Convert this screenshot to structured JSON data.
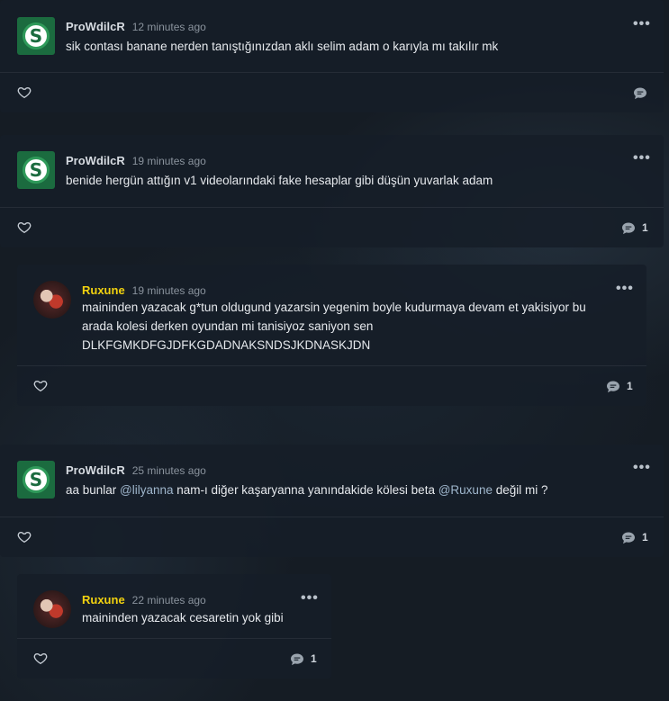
{
  "comments": [
    {
      "author": "ProWdilcR",
      "time": "12 minutes ago",
      "text": "sik contası banane nerden tanıştığınızdan aklı selim adam o karıyla mı takılır mk",
      "reply_count": "",
      "avatar_icon": "s-logo-avatar"
    },
    {
      "author": "ProWdilcR",
      "time": "19 minutes ago",
      "text": "benide hergün attığın v1 videolarındaki fake hesaplar gibi düşün yuvarlak adam",
      "reply_count": "1",
      "avatar_icon": "s-logo-avatar"
    },
    {
      "author": "Ruxune",
      "time": "19 minutes ago",
      "text": "maininden yazacak g*tun oldugund yazarsin yegenim boyle kudurmaya devam et yakisiyor bu arada kolesi derken oyundan mi tanisiyoz saniyon sen DLKFGMKDFGJDFKGDADNAKSNDSJKDNASKJDN",
      "reply_count": "1",
      "avatar_icon": "user-photo-avatar"
    },
    {
      "author": "ProWdilcR",
      "time": "25 minutes ago",
      "text_before": "aa bunlar ",
      "mention1": "@lilyanna",
      "text_mid": " nam-ı diğer kaşaryanna yanındakide kölesi beta ",
      "mention2": "@Ruxune",
      "text_after": " değil mi ?",
      "reply_count": "1",
      "avatar_icon": "s-logo-avatar"
    },
    {
      "author": "Ruxune",
      "time": "22 minutes ago",
      "text": "maininden yazacak cesaretin yok gibi",
      "reply_count": "1",
      "avatar_icon": "user-photo-avatar"
    }
  ],
  "colors": {
    "gold_name": "#f2d20f",
    "mention": "#9fb6cc",
    "card": "#161e28"
  },
  "letter_s": "S",
  "more_label": "•••"
}
